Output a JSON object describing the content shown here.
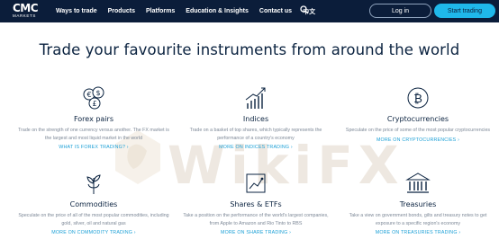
{
  "brand": {
    "mark": "CMC",
    "sub": "MARKETS"
  },
  "nav": {
    "links": [
      "Ways to trade",
      "Products",
      "Platforms",
      "Education & Insights",
      "Contact us",
      "中文"
    ],
    "login": "Log in",
    "start": "Start trading"
  },
  "headline": "Trade your favourite instruments from around the world",
  "cards": [
    {
      "title": "Forex pairs",
      "desc": "Trade on the strength of one currency versus another. The FX market is the largest and most liquid market in the world",
      "more": "WHAT IS FOREX TRADING? ›",
      "icon": "currency-coins-icon"
    },
    {
      "title": "Indices",
      "desc": "Trade on a basket of top shares, which typically represents the performance of a country's economy",
      "more": "MORE ON INDICES TRADING ›",
      "icon": "rising-chart-icon"
    },
    {
      "title": "Cryptocurrencies",
      "desc": "Speculate on the price of some of the most popular cryptocurrencies",
      "more": "MORE ON CRYPTOCURRENCIES ›",
      "icon": "bitcoin-icon"
    },
    {
      "title": "Commodities",
      "desc": "Speculate on the price of all of the most popular commodities, including gold, silver, oil and natural gas",
      "more": "MORE ON COMMODITY TRADING ›",
      "icon": "plant-icon"
    },
    {
      "title": "Shares & ETFs",
      "desc": "Take a position on the performance of the world's largest companies, from Apple to Amazon and Rio Tinto to RBS",
      "more": "MORE ON SHARE TRADING ›",
      "icon": "share-chart-icon"
    },
    {
      "title": "Treasuries",
      "desc": "Take a view on government bonds, gilts and treasury notes to get exposure to a specific region's economy",
      "more": "MORE ON TREASURIES TRADING ›",
      "icon": "bank-building-icon"
    }
  ],
  "watermark": "WikiFX",
  "colors": {
    "nav_bg": "#0b1d3a",
    "accent": "#1fb8ea",
    "link": "#1a9fd6",
    "text": "#0b2340"
  }
}
